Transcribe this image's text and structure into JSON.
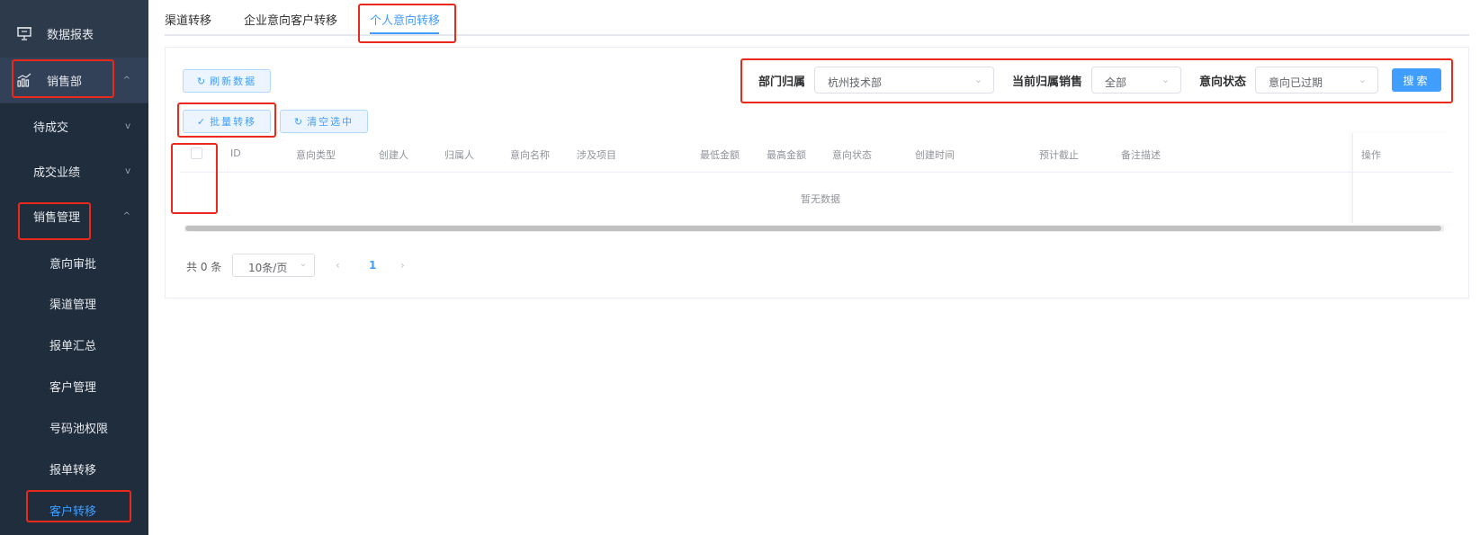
{
  "sidebar": {
    "top_items": [
      {
        "label": "数据报表",
        "icon": "presentation-board-icon"
      },
      {
        "label": "销售部",
        "icon": "chart-bars-icon",
        "arrow": "^"
      }
    ],
    "groups": [
      {
        "label": "待成交",
        "arrow": "v"
      },
      {
        "label": "成交业绩",
        "arrow": "v"
      },
      {
        "label": "销售管理",
        "arrow": "^"
      }
    ],
    "sub_items": [
      "意向审批",
      "渠道管理",
      "报单汇总",
      "客户管理",
      "号码池权限",
      "报单转移",
      "客户转移"
    ],
    "active_sub": "客户转移"
  },
  "tabs": [
    "渠道转移",
    "企业意向客户转移",
    "个人意向转移"
  ],
  "active_tab": "个人意向转移",
  "toolbar": {
    "refresh_label": "刷新数据",
    "batch_transfer_label": "批量转移",
    "clear_selection_label": "清空选中"
  },
  "filters": {
    "dept_label": "部门归属",
    "dept_value": "杭州技术部",
    "sales_label": "当前归属销售",
    "sales_value": "全部",
    "status_label": "意向状态",
    "status_value": "意向已过期",
    "search_label": "搜索"
  },
  "table": {
    "columns": [
      "ID",
      "意向类型",
      "创建人",
      "归属人",
      "意向名称",
      "涉及项目",
      "最低金额",
      "最高金额",
      "意向状态",
      "创建时间",
      "预计截止",
      "备注描述",
      "操作"
    ],
    "empty_text": "暂无数据"
  },
  "pagination": {
    "total_text": "共 0 条",
    "page_size": "10条/页",
    "current_page": "1"
  },
  "colors": {
    "sidebar_bg": "#2d3a4b",
    "submenu_bg": "#1f2d3d",
    "accent": "#409eff",
    "highlight": "#e8291c"
  }
}
